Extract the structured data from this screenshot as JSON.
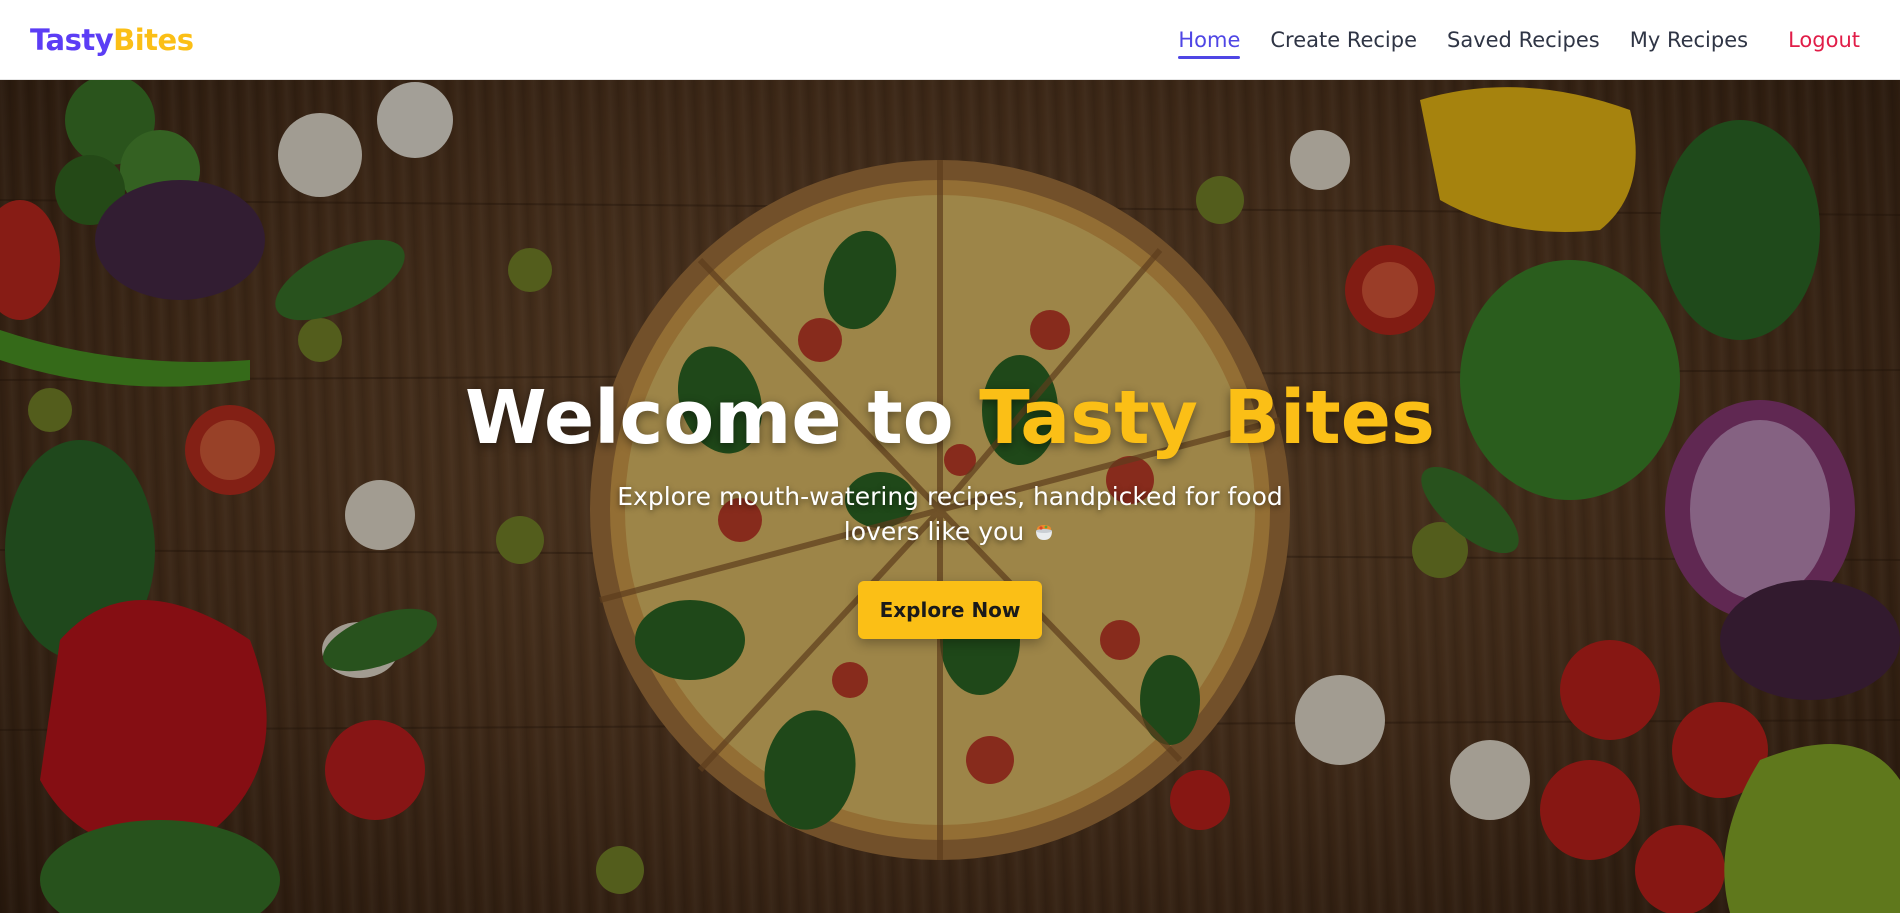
{
  "navbar": {
    "brand_part1": "Tasty",
    "brand_part2": "Bites",
    "links": {
      "home": "Home",
      "create_recipe": "Create Recipe",
      "saved_recipes": "Saved Recipes",
      "my_recipes": "My Recipes",
      "logout": "Logout"
    },
    "active_link": "home"
  },
  "hero": {
    "title_part1": "Welcome to ",
    "title_accent": "Tasty Bites",
    "subtitle": "Explore mouth-watering recipes, handpicked for food lovers like you",
    "subtitle_icon": "cooking-pot-emoji",
    "cta_label": "Explore Now",
    "background_image": "pizza-and-vegetables-on-wooden-table"
  },
  "colors": {
    "brand_primary": "#5b3df5",
    "brand_accent": "#fbbf16",
    "nav_active": "#4f46e5",
    "logout": "#e11d48",
    "nav_text": "#2f3545"
  }
}
